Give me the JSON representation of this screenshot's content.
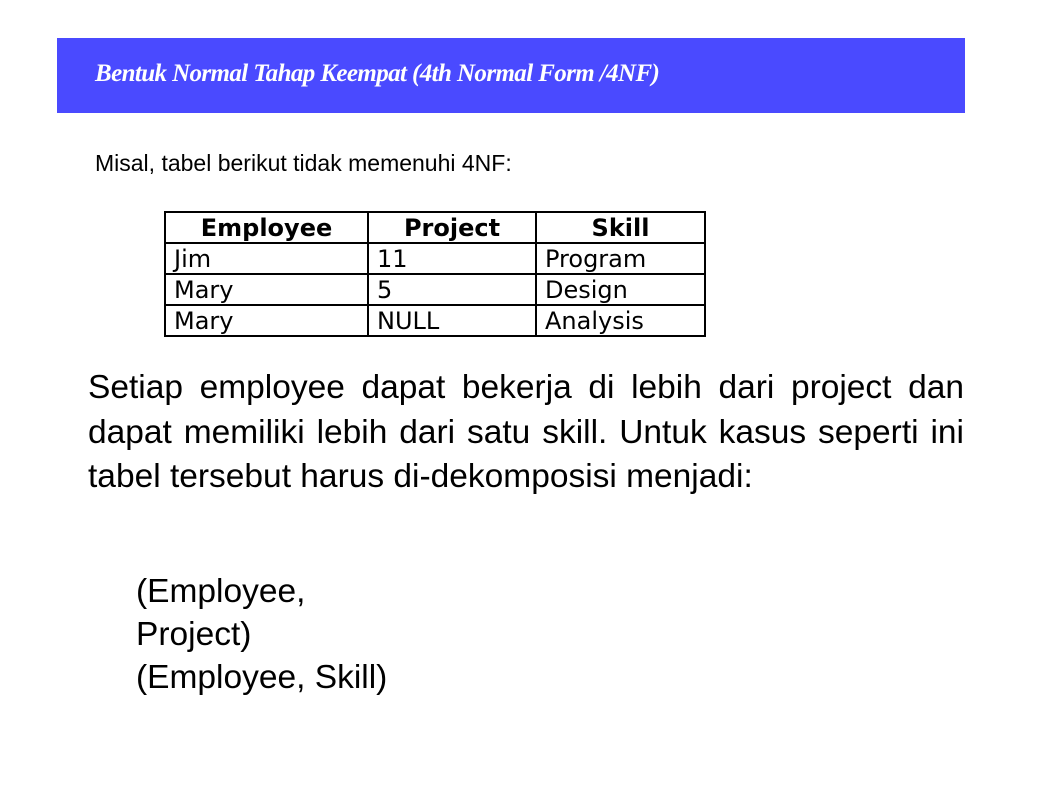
{
  "title": "Bentuk Normal Tahap Keempat (4th Normal Form /4NF)",
  "intro": "Misal, tabel berikut tidak memenuhi 4NF:",
  "table": {
    "headers": [
      "Employee",
      "Project",
      "Skill"
    ],
    "rows": [
      [
        "Jim",
        "11",
        "Program"
      ],
      [
        "Mary",
        "5",
        "Design"
      ],
      [
        "Mary",
        "NULL",
        "Analysis"
      ]
    ]
  },
  "paragraph": "Setiap employee dapat bekerja di lebih dari project dan dapat  memiliki lebih dari satu skill. Untuk kasus seperti ini tabel  tersebut harus di-dekomposisi menjadi:",
  "decomposition": {
    "line1": "(Employee,",
    "line2": "Project)",
    "line3": "(Employee, Skill)"
  },
  "colors": {
    "title_bar": "#4a4aff",
    "title_text": "#ffffff"
  }
}
